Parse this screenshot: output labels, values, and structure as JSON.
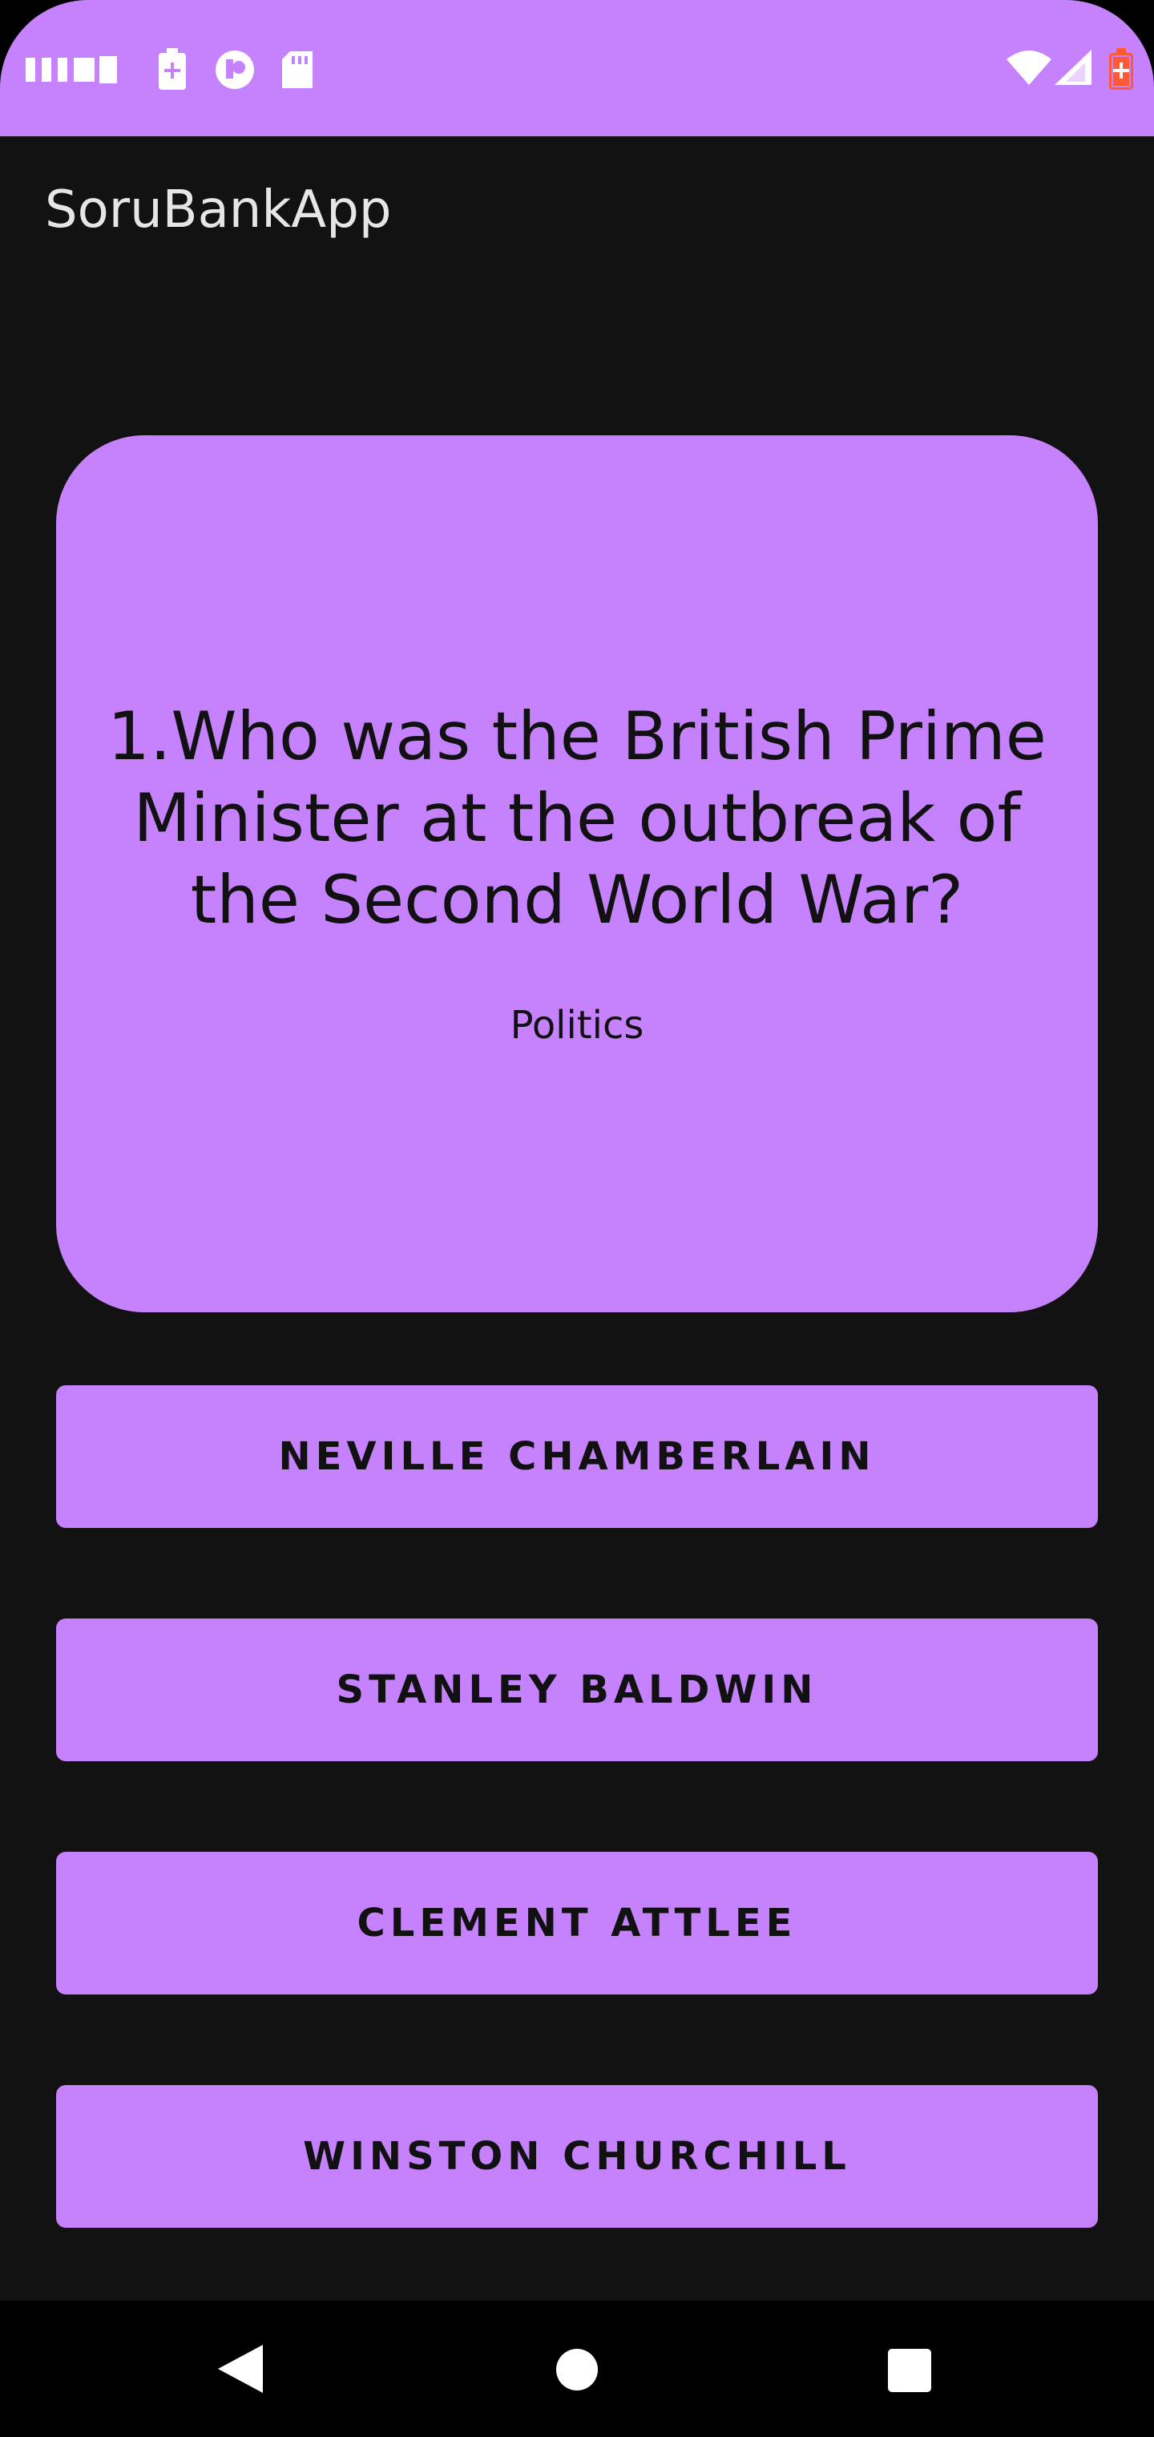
{
  "status_bar": {
    "background": "#c582fc",
    "left_icons": [
      "signal-bars-icon",
      "battery-saver-icon",
      "app-notification-icon",
      "sd-card-icon"
    ],
    "right_icons": [
      "wifi-icon",
      "cell-signal-icon",
      "battery-charging-icon"
    ]
  },
  "app_bar": {
    "title": "SoruBankApp"
  },
  "question": {
    "text": "1.Who was the British Prime Minister at the outbreak of the Second World War?",
    "category": "Politics"
  },
  "answers": [
    {
      "label": "NEVILLE CHAMBERLAIN"
    },
    {
      "label": "STANLEY BALDWIN"
    },
    {
      "label": "CLEMENT ATTLEE"
    },
    {
      "label": "WINSTON CHURCHILL"
    }
  ],
  "navigation": {
    "icons": [
      "back-icon",
      "home-icon",
      "recents-icon"
    ]
  },
  "colors": {
    "accent": "#c582fc",
    "background": "#121212",
    "text_dark": "#111111",
    "title_text": "#e6e6e6"
  }
}
